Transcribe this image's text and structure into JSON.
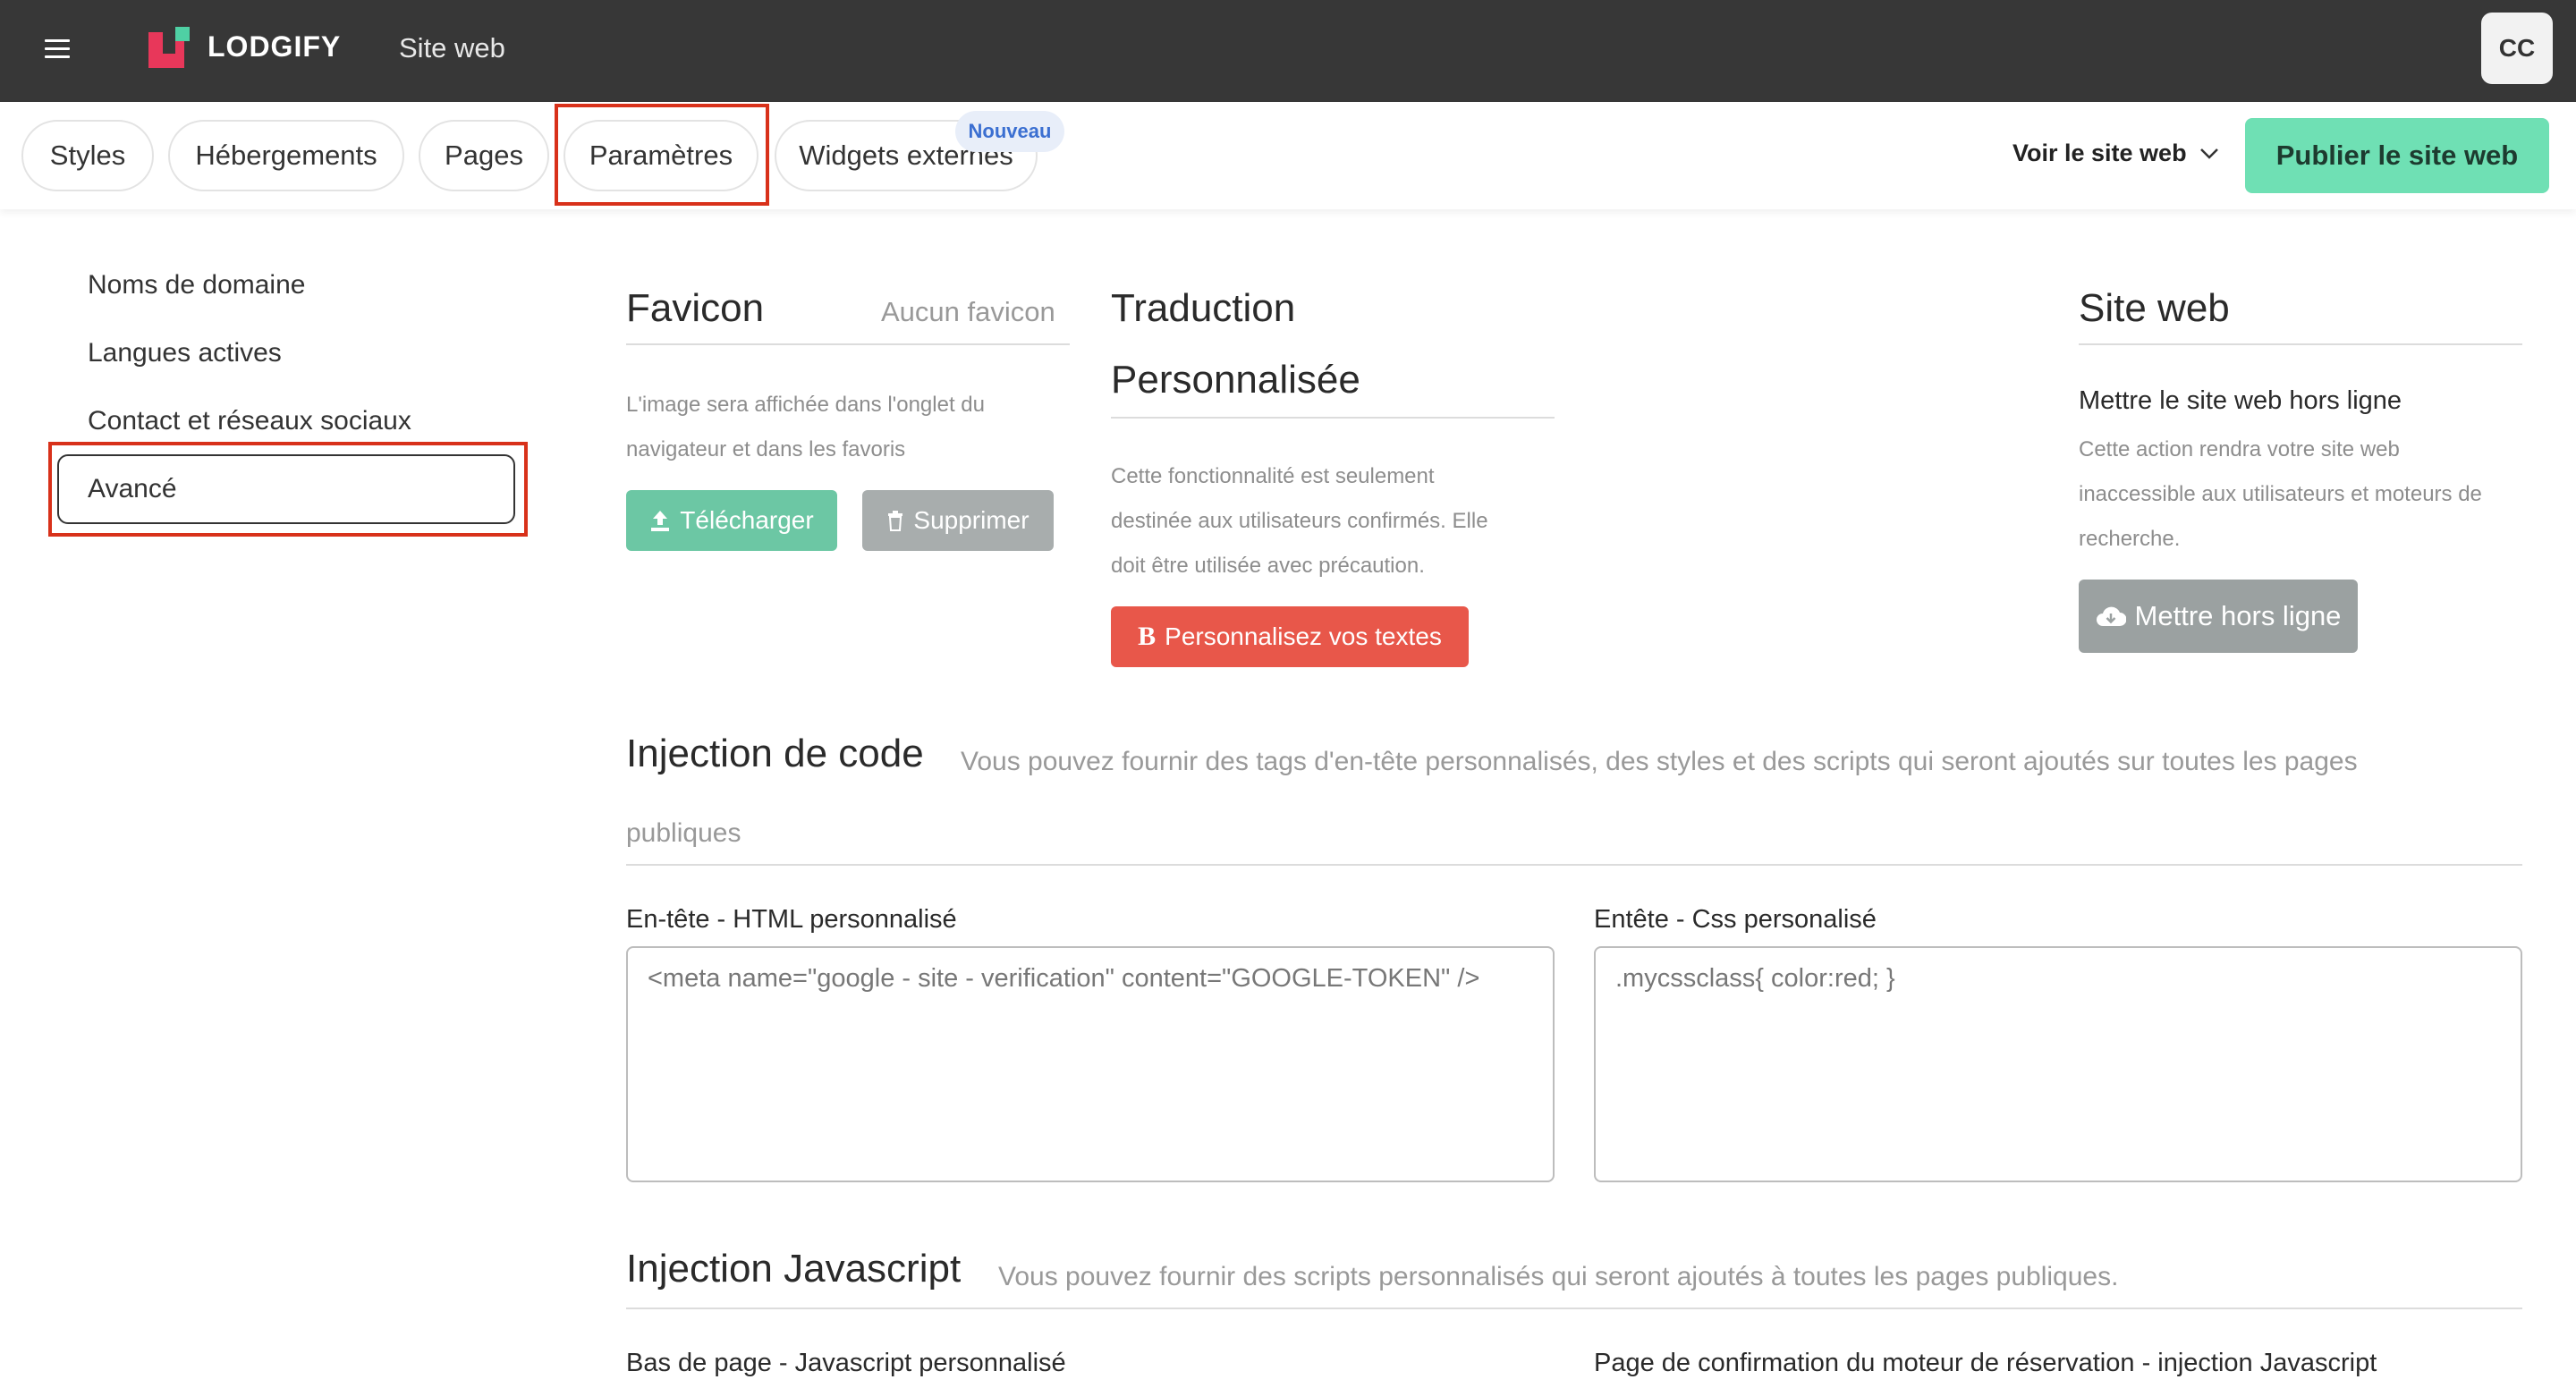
{
  "header": {
    "logo": "LODGIFY",
    "title": "Site web",
    "avatar": "CC"
  },
  "tabs": [
    {
      "label": "Styles"
    },
    {
      "label": "Hébergements"
    },
    {
      "label": "Pages"
    },
    {
      "label": "Paramètres"
    },
    {
      "label": "Widgets externes"
    }
  ],
  "tab_badge": "Nouveau",
  "view_site": "Voir le site web",
  "publish": "Publier le site web",
  "sidebar": {
    "items": [
      {
        "label": "Noms de domaine"
      },
      {
        "label": "Langues actives"
      },
      {
        "label": "Contact et réseaux sociaux"
      },
      {
        "label": "Avancé"
      }
    ]
  },
  "favicon": {
    "title": "Favicon",
    "status": "Aucun favicon",
    "desc_line1": "L'image sera affichée dans l'onglet du",
    "desc_line2": "navigateur et dans les favoris",
    "upload": "Télécharger",
    "delete": "Supprimer"
  },
  "translation": {
    "title_line1": "Traduction",
    "title_line2": "Personnalisée",
    "desc_line1": "Cette fonctionnalité est seulement",
    "desc_line2": "destinée aux utilisateurs confirmés. Elle",
    "desc_line3": "doit être utilisée avec précaution.",
    "button": "Personnalisez vos textes"
  },
  "website": {
    "title": "Site web",
    "subtitle": "Mettre le site web hors ligne",
    "desc_line1": "Cette action rendra votre site web",
    "desc_line2": "inaccessible aux utilisateurs et moteurs de",
    "desc_line3": "recherche.",
    "button": "Mettre hors ligne"
  },
  "code_injection": {
    "title": "Injection de code",
    "desc_line1": "Vous pouvez fournir des tags d'en-tête personnalisés, des styles et des scripts qui seront ajoutés sur toutes les pages",
    "desc_line2": "publiques",
    "html_label": "En-tête - HTML personnalisé",
    "html_placeholder": "<meta name=\"google - site - verification\" content=\"GOOGLE-TOKEN\" />",
    "css_label": "Entête - Css personalisé",
    "css_placeholder": ".mycssclass{ color:red; }"
  },
  "js_injection": {
    "title": "Injection Javascript",
    "desc": "Vous pouvez fournir des scripts personnalisés qui seront ajoutés à toutes les pages publiques.",
    "footer_label": "Bas de page - Javascript personnalisé",
    "confirm_label": "Page de confirmation du moteur de réservation - injection Javascript"
  },
  "colors": {
    "topbar": "#373737",
    "publish": "#6fe0b4",
    "upload": "#6cc7a4",
    "delete": "#a8adad",
    "translate": "#e8574a",
    "offline": "#9ba1a1",
    "highlight": "#d8311a"
  }
}
